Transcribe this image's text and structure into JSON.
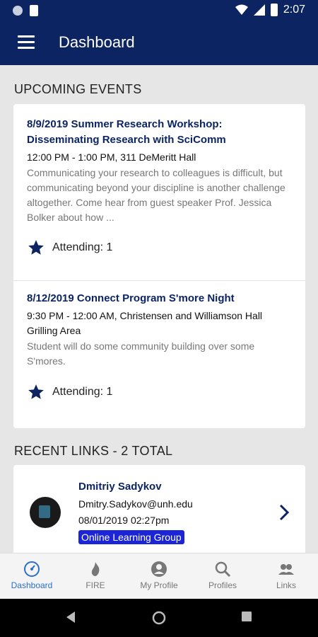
{
  "status_bar": {
    "time": "2:07"
  },
  "app_bar": {
    "title": "Dashboard"
  },
  "events_section": {
    "title": "UPCOMING EVENTS",
    "events": [
      {
        "title": "8/9/2019 Summer Research Workshop: Disseminating Research with SciComm",
        "time": "12:00 PM - 1:00 PM, 311 DeMeritt Hall",
        "description": "Communicating your research to colleagues is difficult, but communicating beyond your discipline is another challenge altogether. Come hear from guest speaker Prof. Jessica Bolker about how ...",
        "attending": "Attending: 1"
      },
      {
        "title": "8/12/2019 Connect Program S'more Night",
        "time": "9:30 PM - 12:00 AM, Christensen and Williamson Hall Grilling Area",
        "description": "Student will do some community building over some S'mores.",
        "attending": "Attending: 1"
      }
    ]
  },
  "links_section": {
    "title": "RECENT LINKS - 2 TOTAL",
    "links": [
      {
        "name": "Dmitriy Sadykov",
        "email": "Dmitry.Sadykov@unh.edu",
        "date": "08/01/2019 02:27pm",
        "group": "Online Learning Group"
      }
    ]
  },
  "bottom_nav": {
    "items": [
      {
        "label": "Dashboard",
        "icon": "dashboard-icon",
        "active": true
      },
      {
        "label": "FIRE",
        "icon": "fire-icon",
        "active": false
      },
      {
        "label": "My Profile",
        "icon": "account-circle-icon",
        "active": false
      },
      {
        "label": "Profiles",
        "icon": "search-icon",
        "active": false
      },
      {
        "label": "Links",
        "icon": "people-icon",
        "active": false
      }
    ]
  },
  "colors": {
    "primary": "#0c2461",
    "accent": "#2a6fc9",
    "badge": "#1b25d6"
  }
}
